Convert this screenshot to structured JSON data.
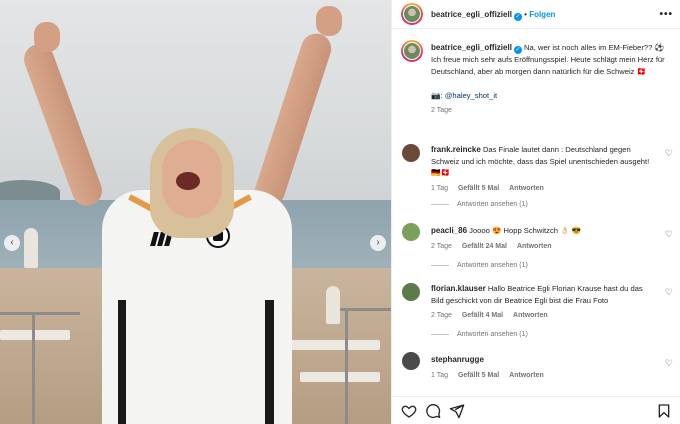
{
  "header": {
    "username": "beatrice_egli_offiziell",
    "follow_label": "Folgen",
    "more_label": "•••"
  },
  "caption": {
    "username": "beatrice_egli_offiziell",
    "line1": "Na, wer ist noch alles im EM-Fieber?? ⚽",
    "line2": "Ich freue mich sehr aufs Eröffnungsspiel. Heute schlägt mein Herz für Deutschland, aber ab morgen dann natürlich für die Schweiz 🇨🇭",
    "credit_prefix": "📷: ",
    "credit_mention": "@haley_shot_it",
    "time": "2 Tage"
  },
  "comments": [
    {
      "username": "frank.reincke",
      "text": "Das Finale lautet dann : Deutschland gegen Schweiz und ich möchte, dass das Spiel unentschieden ausgeht! 🇩🇪🇨🇭",
      "time": "1 Tag",
      "likes": "Gefällt 5 Mal",
      "reply": "Antworten",
      "view_replies": "Antworten ansehen (1)",
      "avatar_color": "#6b4a3a"
    },
    {
      "username": "peacli_86",
      "text": "Joooo 😍 Hopp Schwitzch 👌🏻 😎",
      "time": "2 Tage",
      "likes": "Gefällt 24 Mal",
      "reply": "Antworten",
      "view_replies": "Antworten ansehen (1)",
      "avatar_color": "#7aa05a"
    },
    {
      "username": "florian.klauser",
      "text": "Hallo Beatrice Egli Florian Krause hast du das Bild geschickt von dir Beatrice Egli bist die Frau Foto",
      "time": "2 Tage",
      "likes": "Gefällt 4 Mal",
      "reply": "Antworten",
      "view_replies": "Antworten ansehen (1)",
      "avatar_color": "#5d7a4a"
    },
    {
      "username": "stephanrugge",
      "text": "",
      "time": "1 Tag",
      "likes": "Gefällt 5 Mal",
      "reply": "Antworten",
      "avatar_color": "#4a4a4a"
    }
  ],
  "colors": {
    "accent": "#0095f6",
    "link": "#00376b",
    "muted": "#737373"
  },
  "icons": [
    "heart-icon",
    "comment-icon",
    "share-icon",
    "bookmark-icon",
    "chevron-left-icon",
    "chevron-right-icon",
    "verified-icon"
  ]
}
